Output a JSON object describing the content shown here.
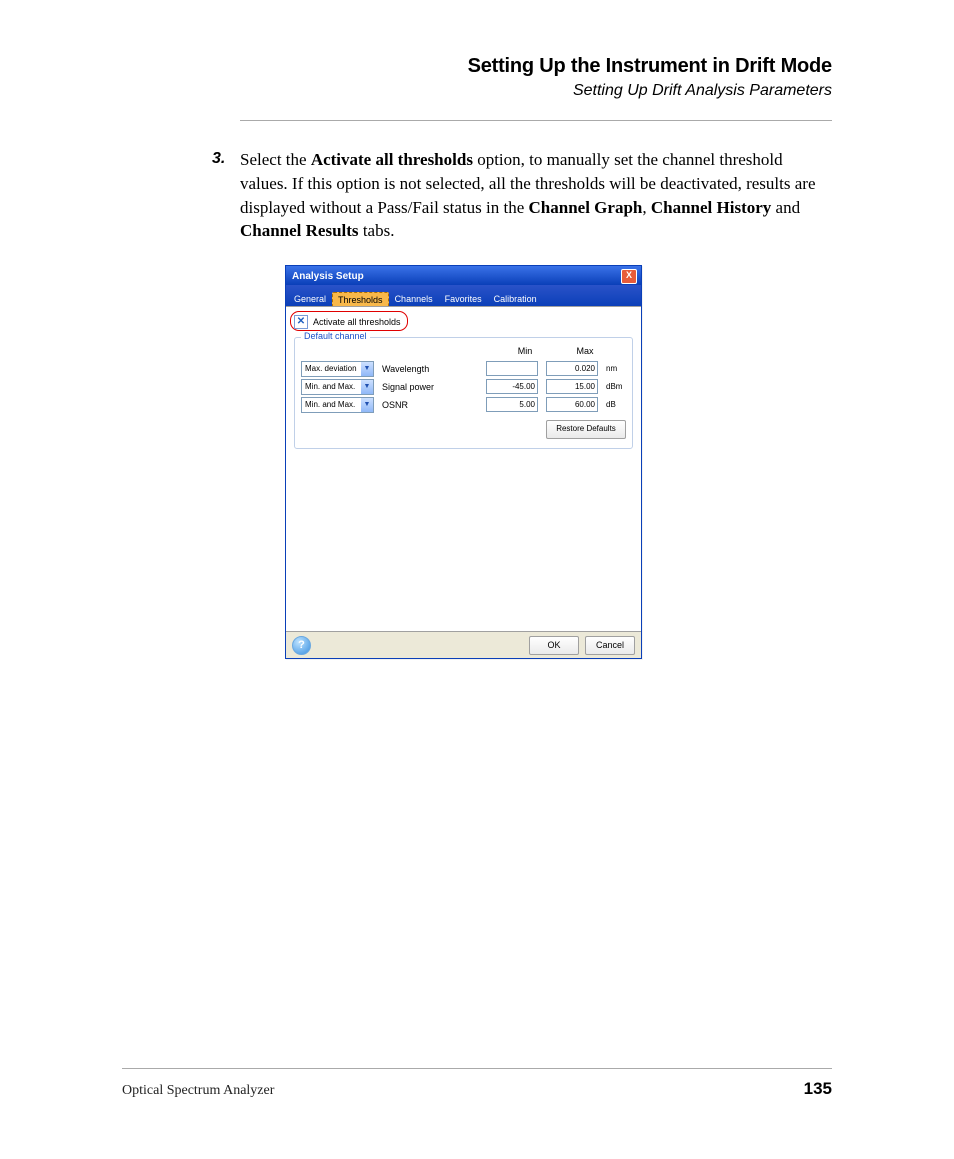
{
  "header": {
    "title": "Setting Up the Instrument in Drift Mode",
    "subtitle": "Setting Up Drift Analysis Parameters"
  },
  "step": {
    "number": "3.",
    "text_pre": "Select the ",
    "bold1": "Activate all thresholds",
    "text_mid1": " option, to manually set the channel threshold values. If this option is not selected, all the thresholds will be deactivated, results are displayed without a Pass/Fail status in the ",
    "bold2": "Channel Graph",
    "sep2": ", ",
    "bold3": "Channel History",
    "sep3": " and ",
    "bold4": "Channel Results",
    "text_end": " tabs."
  },
  "dialog": {
    "title": "Analysis Setup",
    "close": "X",
    "tabs": [
      "General",
      "Thresholds",
      "Channels",
      "Favorites",
      "Calibration"
    ],
    "activate_label": "Activate all thresholds",
    "check_mark": "✕",
    "group_title": "Default channel",
    "col_min": "Min",
    "col_max": "Max",
    "rows": [
      {
        "combo": "Max. deviation",
        "label": "Wavelength",
        "min": "",
        "max": "0.020",
        "unit": "nm"
      },
      {
        "combo": "Min. and Max.",
        "label": "Signal power",
        "min": "-45.00",
        "max": "15.00",
        "unit": "dBm"
      },
      {
        "combo": "Min. and Max.",
        "label": "OSNR",
        "min": "5.00",
        "max": "60.00",
        "unit": "dB"
      }
    ],
    "restore": "Restore Defaults",
    "help": "?",
    "ok": "OK",
    "cancel": "Cancel"
  },
  "footer": {
    "product": "Optical Spectrum Analyzer",
    "page": "135"
  }
}
